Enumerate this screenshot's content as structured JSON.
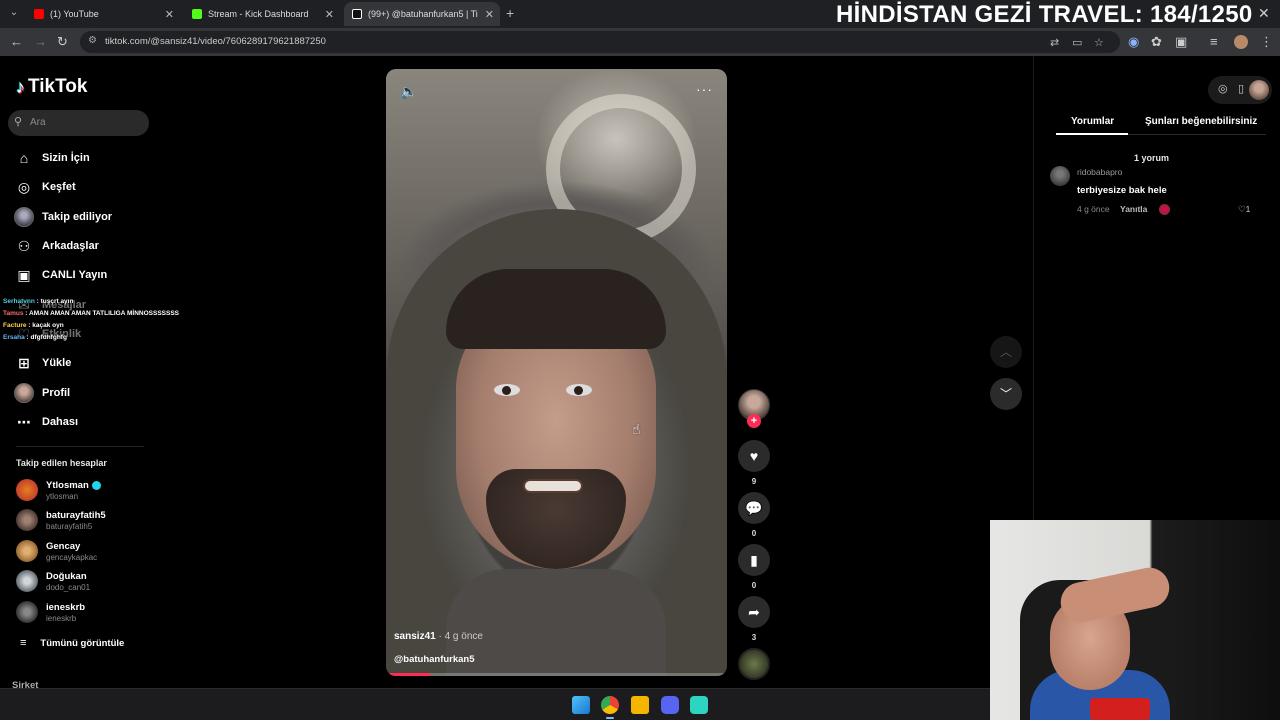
{
  "browser": {
    "tabs": [
      {
        "title": "(1) YouTube",
        "color": "#ff0000"
      },
      {
        "title": "Stream - Kick Dashboard",
        "color": "#53fc18"
      },
      {
        "title": "(99+) @batuhanfurkan5 | Ti",
        "color": "#ffffff"
      }
    ],
    "url": "tiktok.com/@sansiz41/video/7606289179621887250"
  },
  "stream_overlay": {
    "title": "HİNDİSTAN GEZİ TRAVEL: 184/1250"
  },
  "tiktok": {
    "logo": "TikTok",
    "search_placeholder": "Ara",
    "menu": [
      {
        "label": "Sizin İçin",
        "icon": "home-icon"
      },
      {
        "label": "Keşfet",
        "icon": "compass-icon"
      },
      {
        "label": "Takip ediliyor",
        "icon": "avatar"
      },
      {
        "label": "Arkadaşlar",
        "icon": "friends-icon"
      },
      {
        "label": "CANLI Yayın",
        "icon": "live-icon"
      },
      {
        "label": "Mesajlar",
        "icon": "messages-icon"
      },
      {
        "label": "Etkinlik",
        "icon": "activity-icon"
      },
      {
        "label": "Yükle",
        "icon": "upload-icon"
      },
      {
        "label": "Profil",
        "icon": "avatar"
      },
      {
        "label": "Dahası",
        "icon": "more-icon"
      }
    ],
    "following_heading": "Takip edilen hesaplar",
    "following": [
      {
        "name": "Ytlosman",
        "handle": "ytlosman",
        "verified": true,
        "color": "#c0392b"
      },
      {
        "name": "baturayfatih5",
        "handle": "baturayfatih5",
        "verified": false,
        "color": "#5a4a42"
      },
      {
        "name": "Gencay",
        "handle": "gencaykapkac",
        "verified": false,
        "color": "#c98a3a"
      },
      {
        "name": "Doğukan",
        "handle": "dodo_can01",
        "verified": false,
        "color": "#7a8a94"
      },
      {
        "name": "ieneskrb",
        "handle": "ieneskrb",
        "verified": false,
        "color": "#444444"
      }
    ],
    "show_all": "Tümünü görüntüle",
    "company": "Şirket"
  },
  "chat": [
    {
      "user": "Serhatvnn",
      "msg": "tuşçrt ayın",
      "color": "#4dd0e1"
    },
    {
      "user": "Tamus",
      "msg": "AMAN AMAN AMAN TATLILIGA MİNNOSSSSSSS",
      "color": "#ff6b6b"
    },
    {
      "user": "Facture",
      "msg": "kaçak oyn",
      "color": "#ffd54f"
    },
    {
      "user": "Ersaha",
      "msg": "dfgfdhfghfg",
      "color": "#64b5f6"
    }
  ],
  "video": {
    "author": "sansiz41",
    "ago": "· 4 g önce",
    "caption": "@batuhanfurkan5",
    "progress": 0.13,
    "likes": "9",
    "comments": "0",
    "saves": "0",
    "shares": "3"
  },
  "comments_panel": {
    "tab_comments": "Yorumlar",
    "tab_suggest": "Şunları beğenebilirsiniz",
    "count": "1 yorum",
    "comment": {
      "user": "ridobabapro",
      "text": "terbiyesize bak hele",
      "ago": "4 g önce",
      "reply": "Yanıtla",
      "likes": "1"
    }
  }
}
